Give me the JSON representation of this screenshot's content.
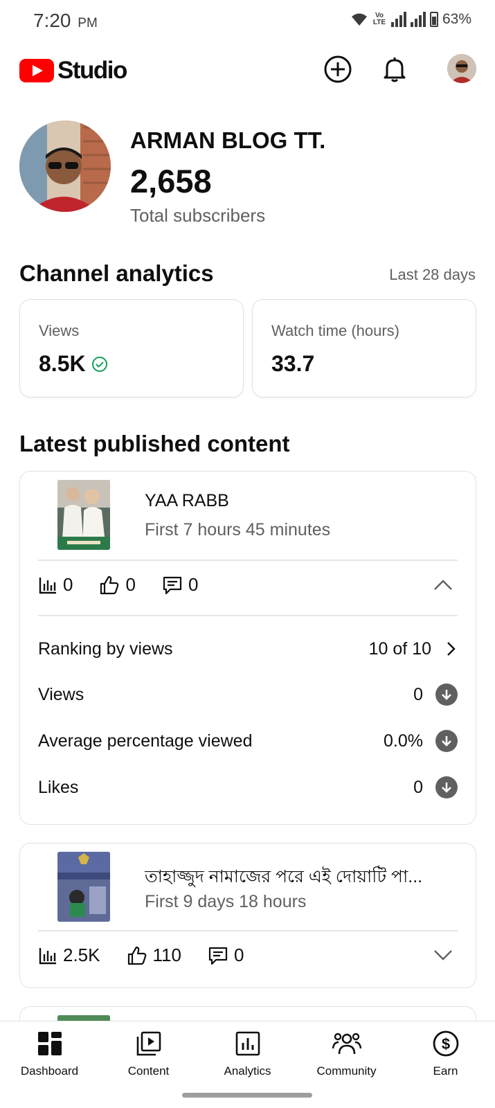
{
  "status_bar": {
    "time": "7:20",
    "period": "PM",
    "network": "Vo LTE",
    "battery": "63%"
  },
  "header": {
    "logo_text": "Studio",
    "brand_color": "#ff0000",
    "icons": [
      "create-icon",
      "notifications-icon",
      "account-avatar"
    ]
  },
  "channel": {
    "name": "ARMAN BLOG TT.",
    "subscribers": "2,658",
    "subscribers_label": "Total subscribers"
  },
  "analytics": {
    "title": "Channel analytics",
    "range": "Last 28 days",
    "cards": [
      {
        "label": "Views",
        "value": "8.5K",
        "badge": "check-circle-icon",
        "badge_color": "#0f9d58"
      },
      {
        "label": "Watch time (hours)",
        "value": "33.7"
      }
    ]
  },
  "latest": {
    "title": "Latest published content",
    "videos": [
      {
        "title": "YAA RABB",
        "subtitle": "First 7 hours 45 minutes",
        "views": "0",
        "likes": "0",
        "comments": "0",
        "expanded": true,
        "details": [
          {
            "label": "Ranking by views",
            "value": "10 of 10",
            "icon": "chevron-right-icon"
          },
          {
            "label": "Views",
            "value": "0",
            "icon": "arrow-down-circle-icon"
          },
          {
            "label": "Average percentage viewed",
            "value": "0.0%",
            "icon": "arrow-down-circle-icon"
          },
          {
            "label": "Likes",
            "value": "0",
            "icon": "arrow-down-circle-icon"
          }
        ]
      },
      {
        "title": "তাহাজ্জুদ নামাজের পরে এই দোয়াটি পা...",
        "subtitle": "First 9 days 18 hours",
        "views": "2.5K",
        "likes": "110",
        "comments": "0",
        "expanded": false
      }
    ]
  },
  "bottom_nav": {
    "items": [
      {
        "label": "Dashboard",
        "icon": "dashboard-icon",
        "active": true
      },
      {
        "label": "Content",
        "icon": "content-icon"
      },
      {
        "label": "Analytics",
        "icon": "analytics-icon"
      },
      {
        "label": "Community",
        "icon": "community-icon"
      },
      {
        "label": "Earn",
        "icon": "earn-icon"
      }
    ]
  }
}
